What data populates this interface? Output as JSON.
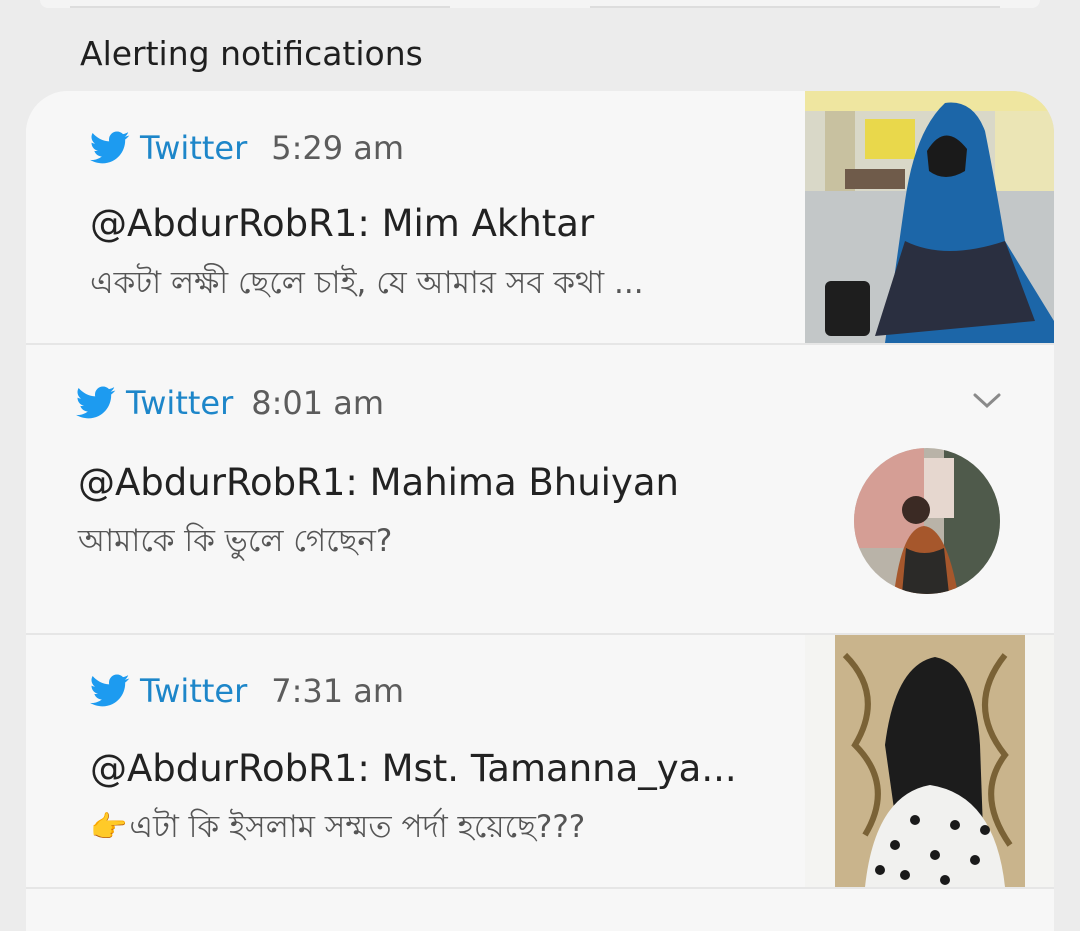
{
  "section_title": "Alerting notifications",
  "notifications": [
    {
      "app": "Twitter",
      "time": "5:29 am",
      "title": "@AbdurRobR1: Mim Akhtar",
      "body": "একটা লক্ষী ছেলে চাই, যে আমার সব কথা ...",
      "image": "woman-blue-hijab-photo"
    },
    {
      "app": "Twitter",
      "time": "8:01 am",
      "title": "@AbdurRobR1: Mahima Bhuiyan",
      "body": "আমাকে কি ভুলে গেছেন?",
      "image": "woman-avatar-blurred"
    },
    {
      "app": "Twitter",
      "time": "7:31 am",
      "title": "@AbdurRobR1: Mst. Tamanna_ya...",
      "body_emoji": "👉",
      "body": "এটা কি ইসলাম সম্মত পর্দা হয়েছে???",
      "image": "woman-niqab-polka-dot-photo"
    }
  ],
  "icons": {
    "app_icon": "twitter-bird-icon",
    "expand_icon": "chevron-down-icon"
  },
  "colors": {
    "twitter_blue": "#1d86c9",
    "background": "#ececec",
    "card": "#f7f7f7"
  }
}
